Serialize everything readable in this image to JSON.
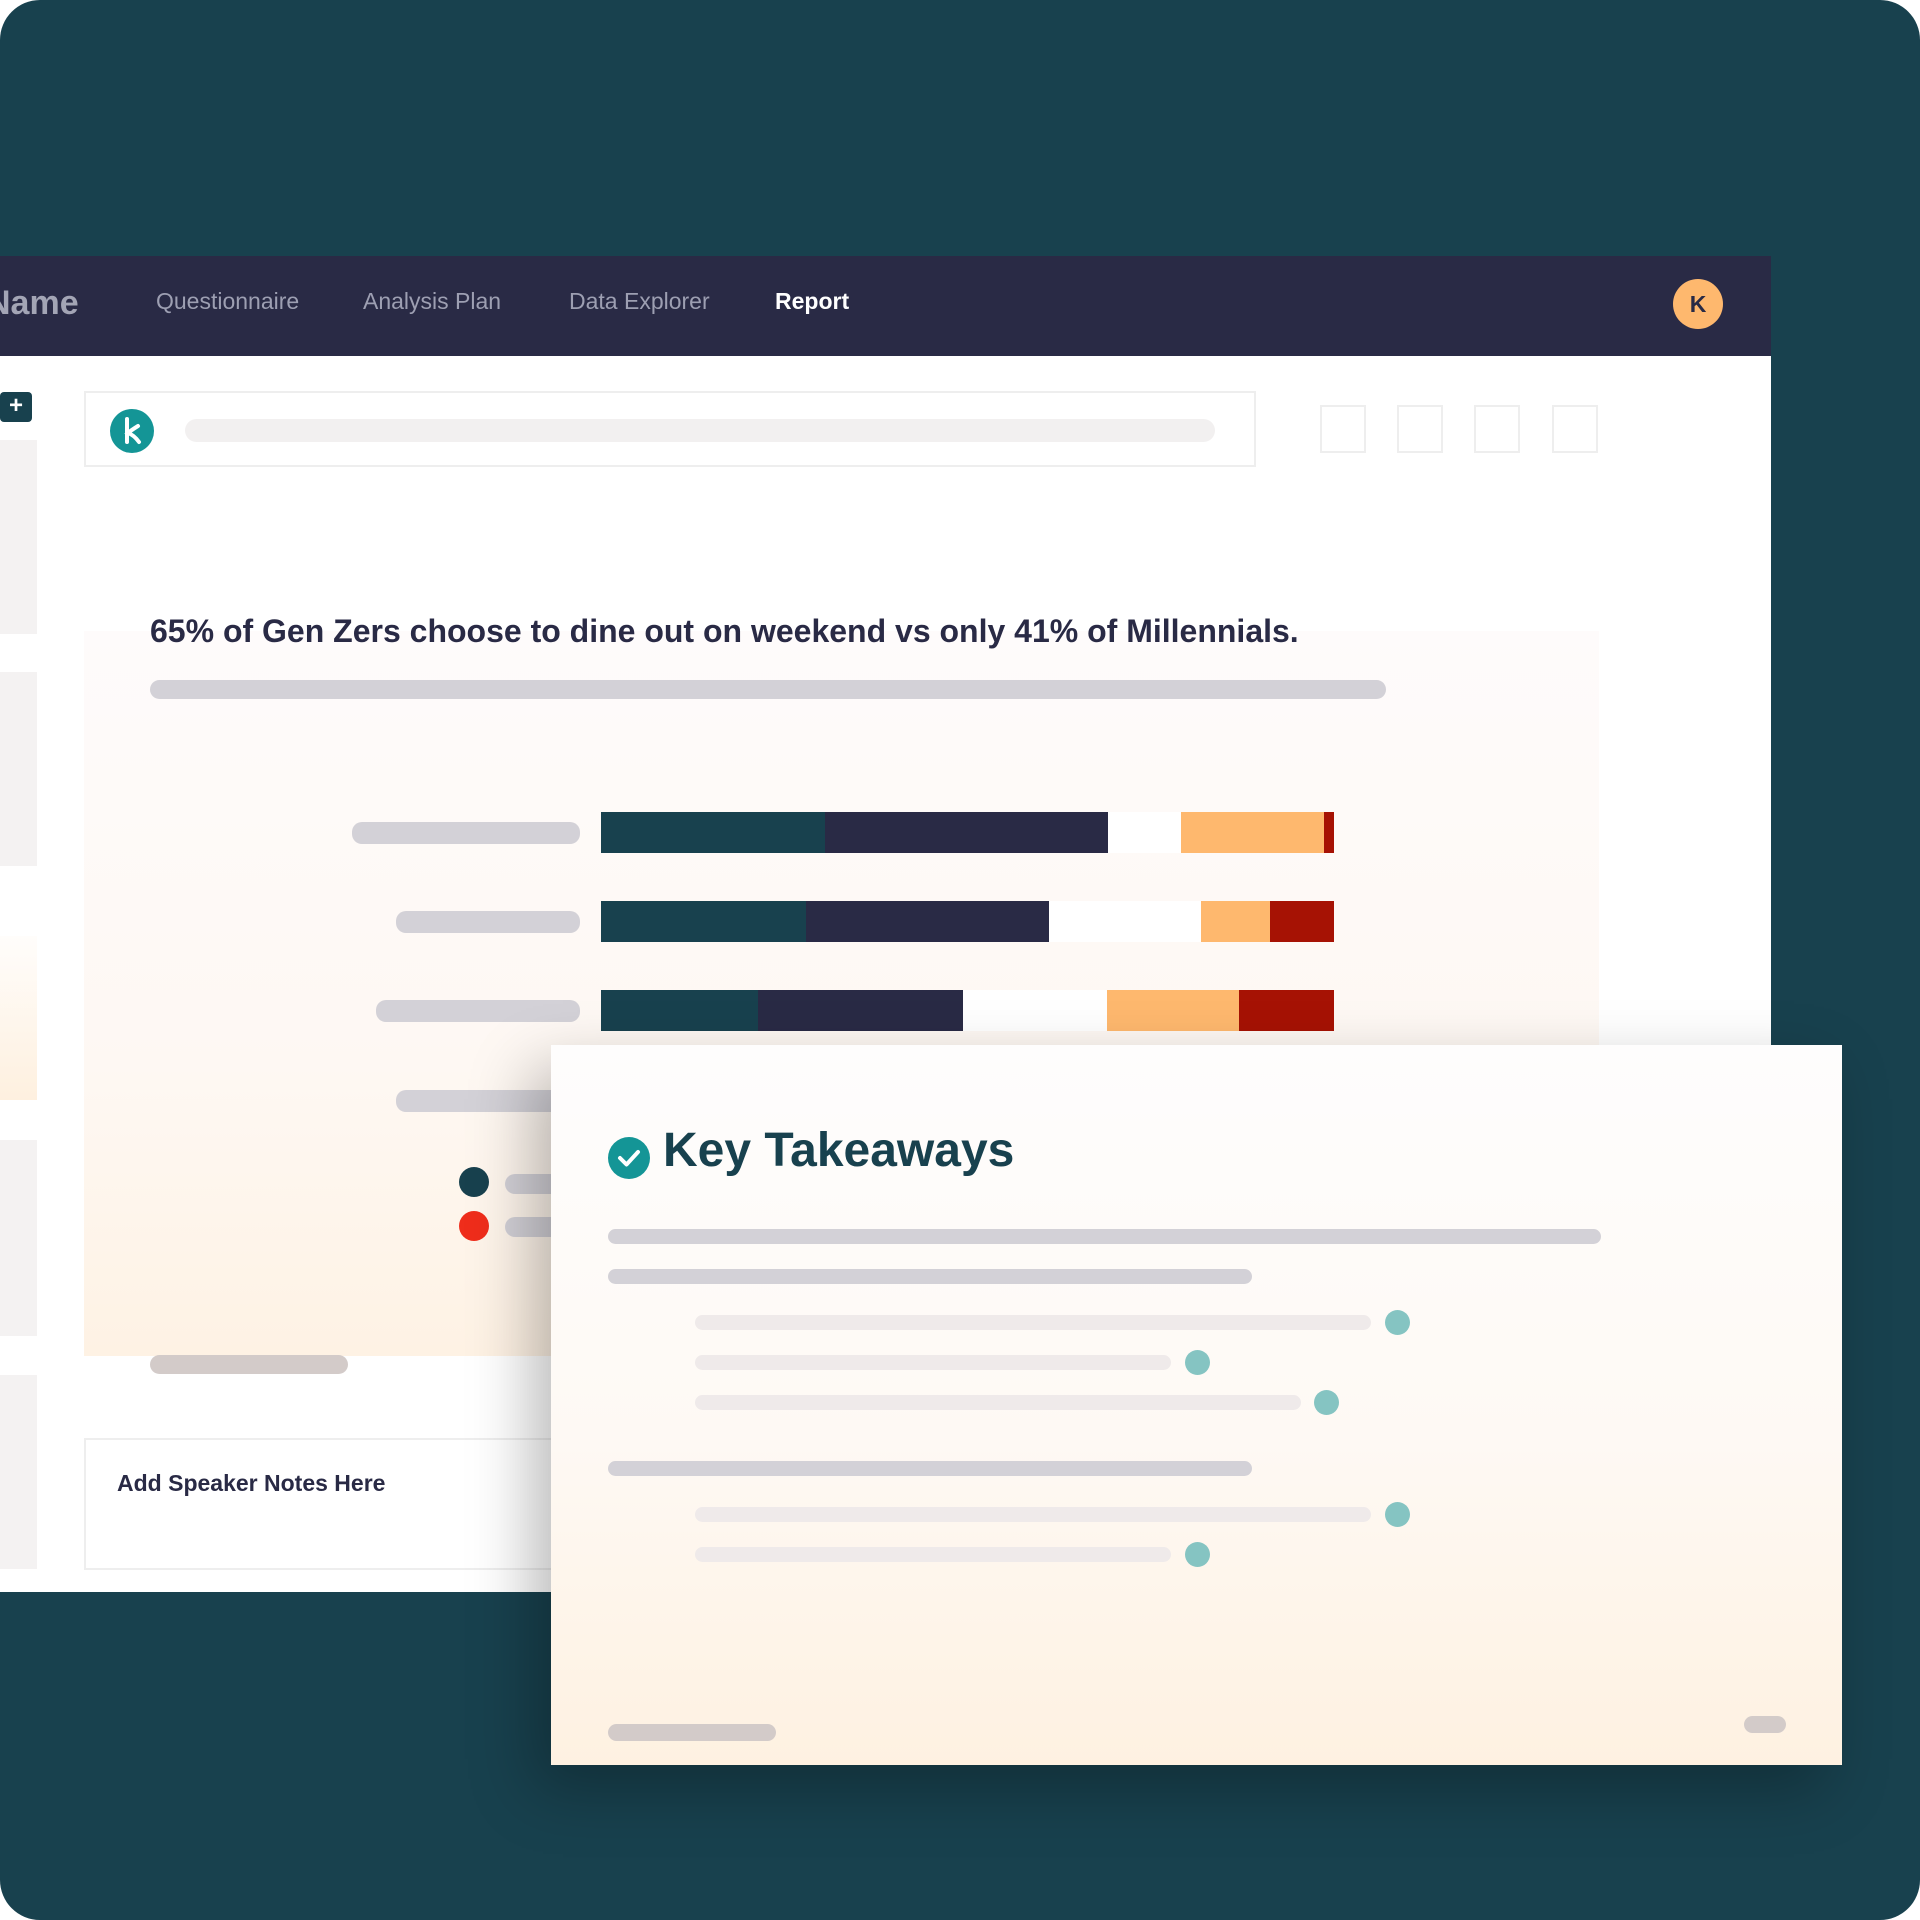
{
  "nav": {
    "app_name": "Name",
    "items": [
      {
        "label": "Questionnaire"
      },
      {
        "label": "Analysis Plan"
      },
      {
        "label": "Data Explorer"
      },
      {
        "label": "Report"
      }
    ],
    "active_item": "Report",
    "avatar_initial": "K"
  },
  "toolbar": {
    "logo_icon": "k-logo-icon"
  },
  "slide": {
    "headline": "65% of Gen Zers choose to dine out on weekend vs only 41% of Millennials."
  },
  "chart_data": {
    "type": "bar",
    "orientation": "horizontal",
    "stacked": true,
    "percent_stacked": true,
    "categories": [
      "",
      "",
      ""
    ],
    "series": [
      {
        "color": "#18414e",
        "values": [
          30.6,
          27.9,
          21.4
        ]
      },
      {
        "color": "#292a45",
        "values": [
          38.6,
          33.2,
          28.0
        ]
      },
      {
        "color": "#ffffff",
        "values": [
          9.9,
          20.7,
          19.7
        ]
      },
      {
        "color": "#feb86e",
        "values": [
          19.5,
          9.5,
          17.9
        ]
      },
      {
        "color": "#a61204",
        "values": [
          1.4,
          8.7,
          13.0
        ]
      }
    ],
    "legend_colors": [
      "#18414e",
      "#ef2d1b"
    ],
    "legend_position": "bottom-left"
  },
  "notes": {
    "label": "Add Speaker Notes Here"
  },
  "takeaways": {
    "title": "Key Takeaways",
    "icon": "check-circle-icon"
  },
  "colors": {
    "background": "#18414e",
    "nav_bg": "#292a45",
    "accent_teal": "#149596",
    "avatar": "#feb86e",
    "bullet_dot": "#85c4c2"
  }
}
